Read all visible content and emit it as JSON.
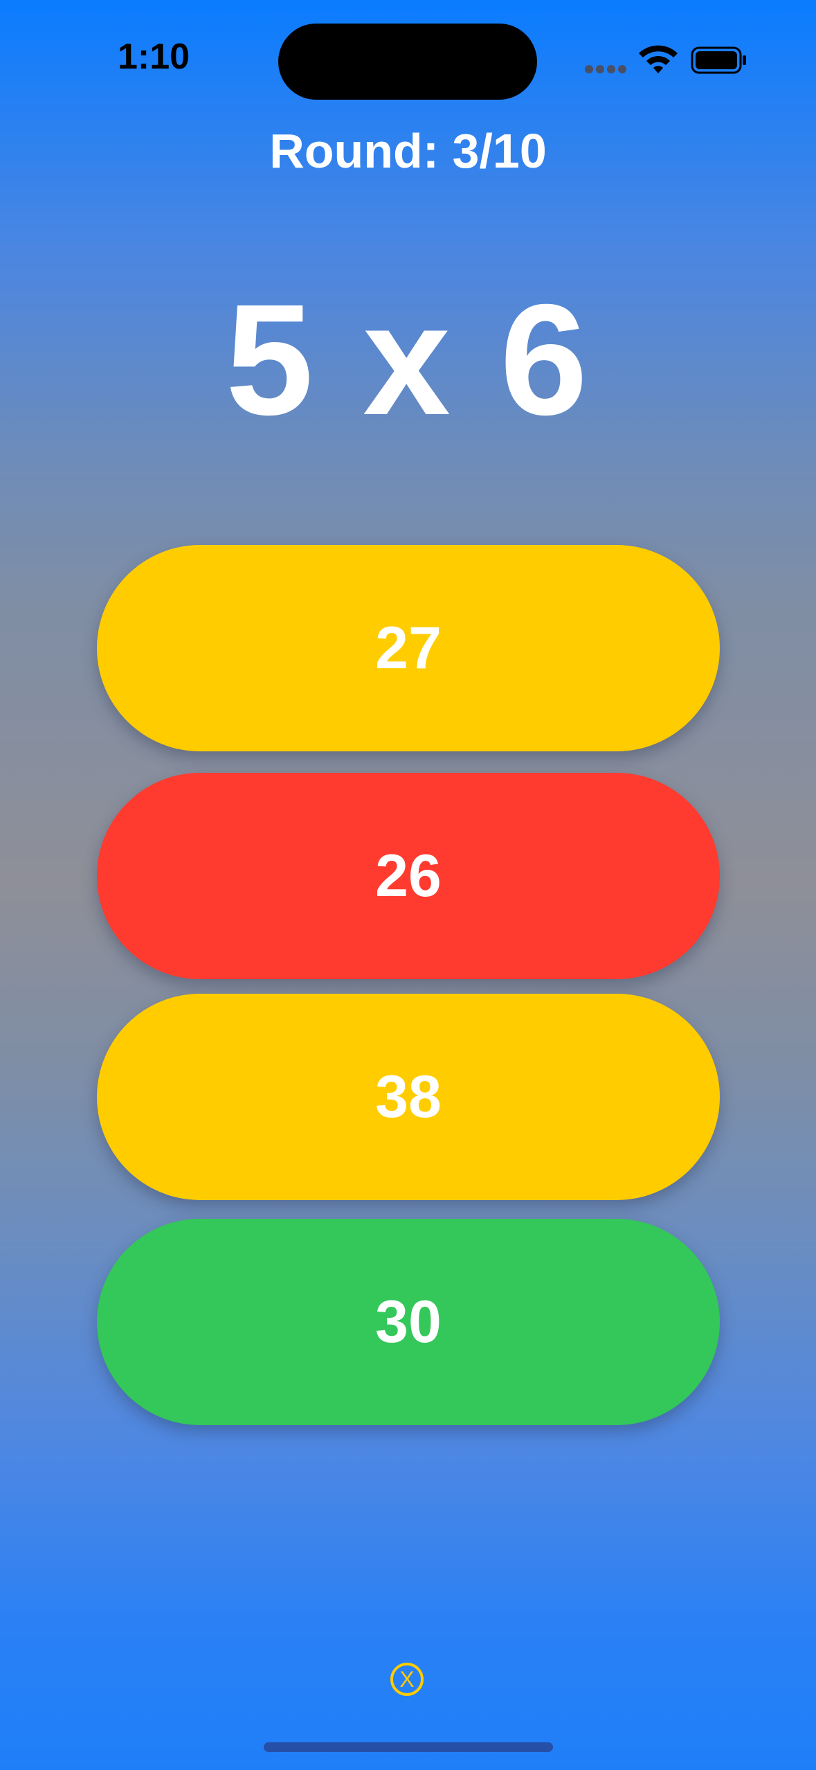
{
  "status_bar": {
    "time": "1:10"
  },
  "game": {
    "round_text": "Round: 3/10",
    "question": "5 x 6",
    "answers": [
      "27",
      "26",
      "38",
      "30"
    ],
    "close_symbol": "X"
  },
  "colors": {
    "yellow": "#ffcc00",
    "red": "#ff3b30",
    "green": "#34c759",
    "blue_top": "#0a7cff"
  },
  "icons": [
    "cellular-signal-icon",
    "wifi-icon",
    "battery-icon",
    "close-icon"
  ]
}
